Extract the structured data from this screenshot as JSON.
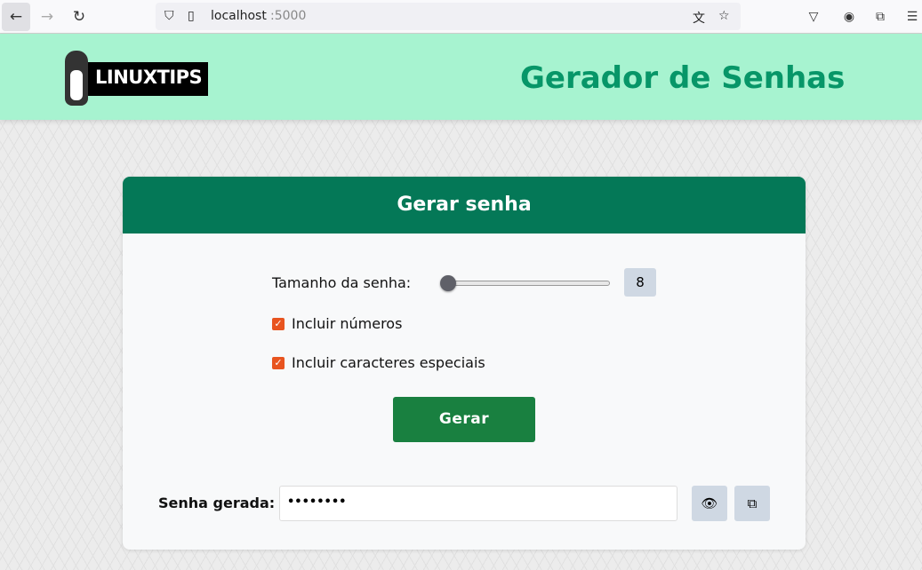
{
  "browser": {
    "url_host": "localhost",
    "url_port": ":5000"
  },
  "header": {
    "logo_text": "LINUXTIPS",
    "title": "Gerador de Senhas"
  },
  "card": {
    "title": "Gerar senha",
    "length_label": "Tamanho da senha:",
    "length_value": "8",
    "length_min": 8,
    "include_numbers_label": "Incluir números",
    "include_numbers": true,
    "include_special_label": "Incluir caracteres especiais",
    "include_special": true,
    "generate_label": "Gerar",
    "generated_label": "Senha gerada:",
    "generated_value": "••••••••"
  }
}
